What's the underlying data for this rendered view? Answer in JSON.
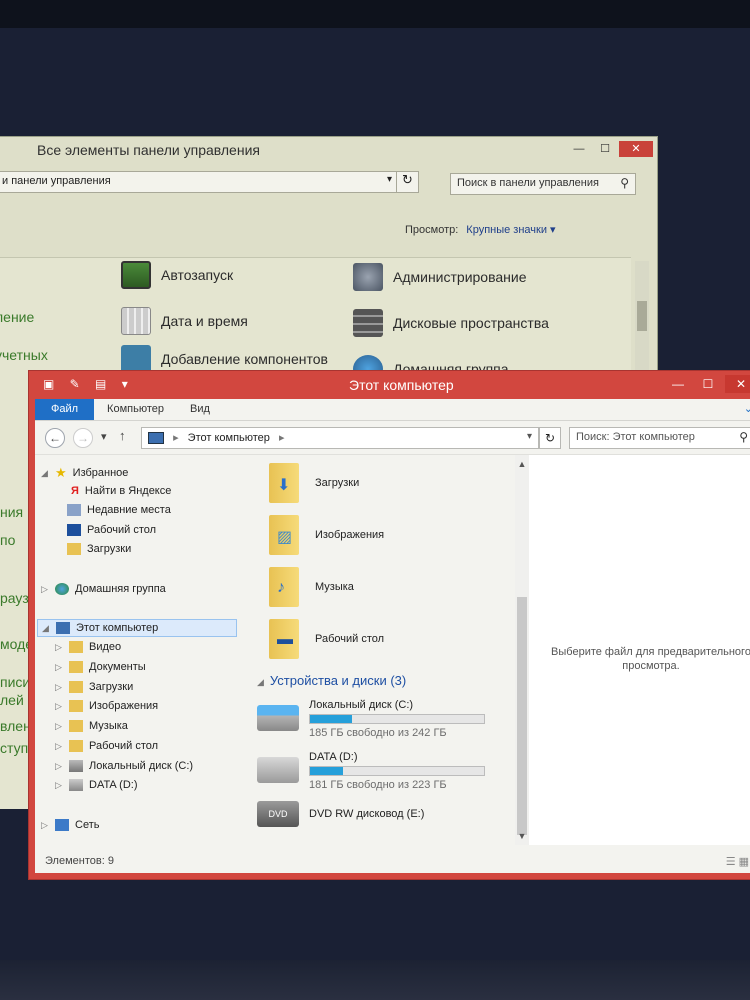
{
  "control_panel": {
    "title": "Все элементы панели управления",
    "address": "и панели управления",
    "search_placeholder": "Поиск в панели управления",
    "view_label": "Просмотр:",
    "view_value": "Крупные значки ▾",
    "items": [
      {
        "label": "Автозапуск"
      },
      {
        "label": "Администрирование"
      },
      {
        "label": "Дата и время"
      },
      {
        "label": "Дисковые пространства"
      },
      {
        "label": "Добавление компонентов"
      },
      {
        "label": "Домашняя группа"
      }
    ],
    "left_fragments": [
      "ление",
      "учетных",
      "",
      "",
      "по",
      "раузе",
      "моде",
      "писи",
      "лей",
      "влен",
      "ступ"
    ]
  },
  "explorer": {
    "title": "Этот компьютер",
    "ribbon_tabs": [
      "Файл",
      "Компьютер",
      "Вид"
    ],
    "path": "Этот компьютер",
    "search_placeholder": "Поиск: Этот компьютер",
    "nav": {
      "favorites": "Избранное",
      "fav_items": [
        "Найти в Яндексе",
        "Недавние места",
        "Рабочий стол",
        "Загрузки"
      ],
      "homegroup": "Домашняя группа",
      "this_pc": "Этот компьютер",
      "pc_items": [
        "Видео",
        "Документы",
        "Загрузки",
        "Изображения",
        "Музыка",
        "Рабочий стол",
        "Локальный диск (C:)",
        "DATA (D:)"
      ],
      "network": "Сеть"
    },
    "folders": [
      "Загрузки",
      "Изображения",
      "Музыка",
      "Рабочий стол"
    ],
    "devices_header": "Устройства и диски (3)",
    "drives": [
      {
        "name": "Локальный диск (C:)",
        "free": "185 ГБ свободно из 242 ГБ",
        "used_fraction": 0.24
      },
      {
        "name": "DATA (D:)",
        "free": "181 ГБ свободно из 223 ГБ",
        "used_fraction": 0.19
      }
    ],
    "dvd": "DVD RW дисковод (E:)",
    "preview_text": "Выберите файл для предварительного просмотра.",
    "status": "Элементов: 9"
  },
  "colors": {
    "explorer_frame": "#d2473f",
    "accent_blue": "#1f6fc6",
    "drive_bar": "#26a0da"
  }
}
